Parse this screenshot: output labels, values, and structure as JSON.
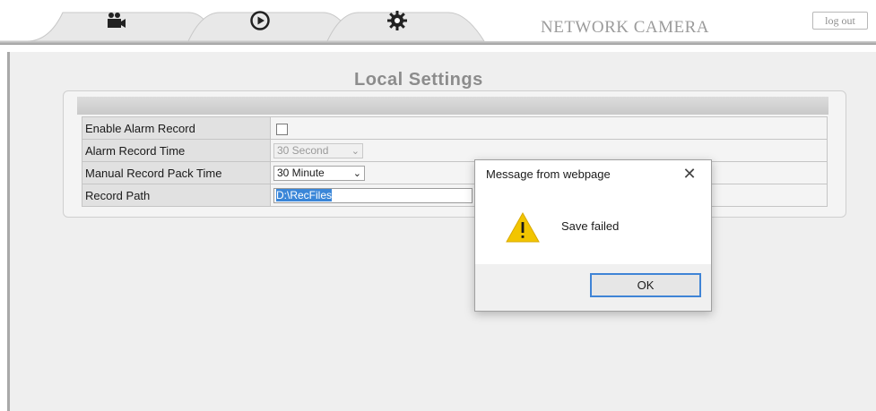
{
  "header": {
    "tabs": [
      {
        "id": "record",
        "icon": "video-record-icon"
      },
      {
        "id": "playback",
        "icon": "play-circle-icon"
      },
      {
        "id": "settings",
        "icon": "gear-icon"
      }
    ],
    "brand": "NETWORK CAMERA",
    "logout_label": "log out"
  },
  "page": {
    "title": "Local Settings"
  },
  "settings": {
    "rows": [
      {
        "label": "Enable Alarm Record",
        "checked": false
      },
      {
        "label": "Alarm Record Time",
        "value": "30 Second",
        "disabled": true
      },
      {
        "label": "Manual Record Pack Time",
        "value": "30 Minute"
      },
      {
        "label": "Record Path",
        "value": "D:\\RecFiles"
      }
    ]
  },
  "dialog": {
    "title": "Message from webpage",
    "message": "Save failed",
    "ok_label": "OK",
    "icon": "warning-icon"
  },
  "colors": {
    "accent": "#3f84d6",
    "warning": "#f2c500",
    "brand_text": "#9b9b9b"
  }
}
